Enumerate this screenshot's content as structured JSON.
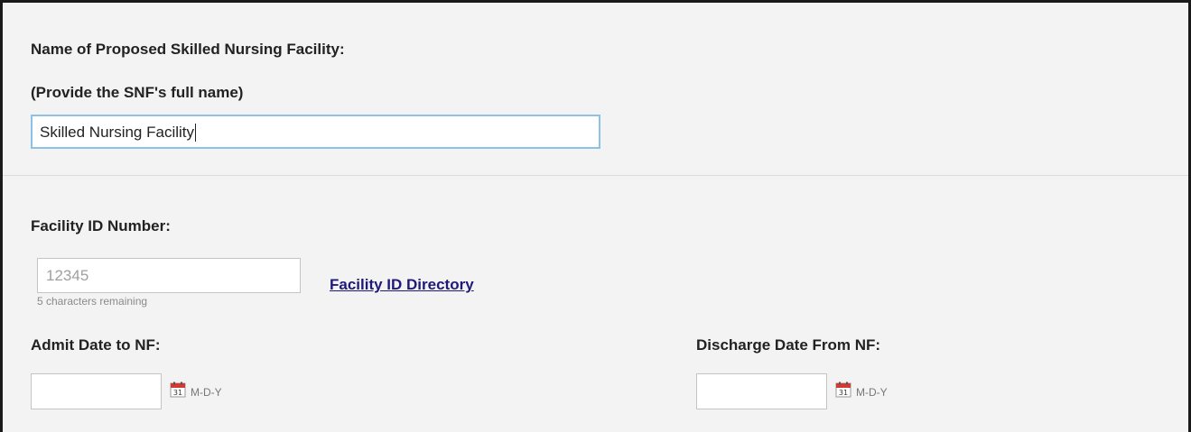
{
  "facility_name": {
    "label": "Name of Proposed Skilled Nursing Facility:",
    "sublabel": "(Provide the SNF's full name)",
    "value": "Skilled Nursing Facility"
  },
  "facility_id": {
    "label": "Facility ID Number:",
    "placeholder": "12345",
    "remaining": "5 characters remaining",
    "directory_link": "Facility ID Directory"
  },
  "admit_date": {
    "label": "Admit Date to NF:",
    "value": "",
    "format": "M-D-Y",
    "icon": "calendar-icon",
    "calendar_day": "31"
  },
  "discharge_date": {
    "label": "Discharge Date From NF:",
    "value": "",
    "format": "M-D-Y",
    "icon": "calendar-icon",
    "calendar_day": "31"
  },
  "colors": {
    "panel_background": "#f3f3f3",
    "link": "#1f1a7a",
    "focus_border": "#8cc1e8",
    "calendar_red": "#d43a2f"
  }
}
